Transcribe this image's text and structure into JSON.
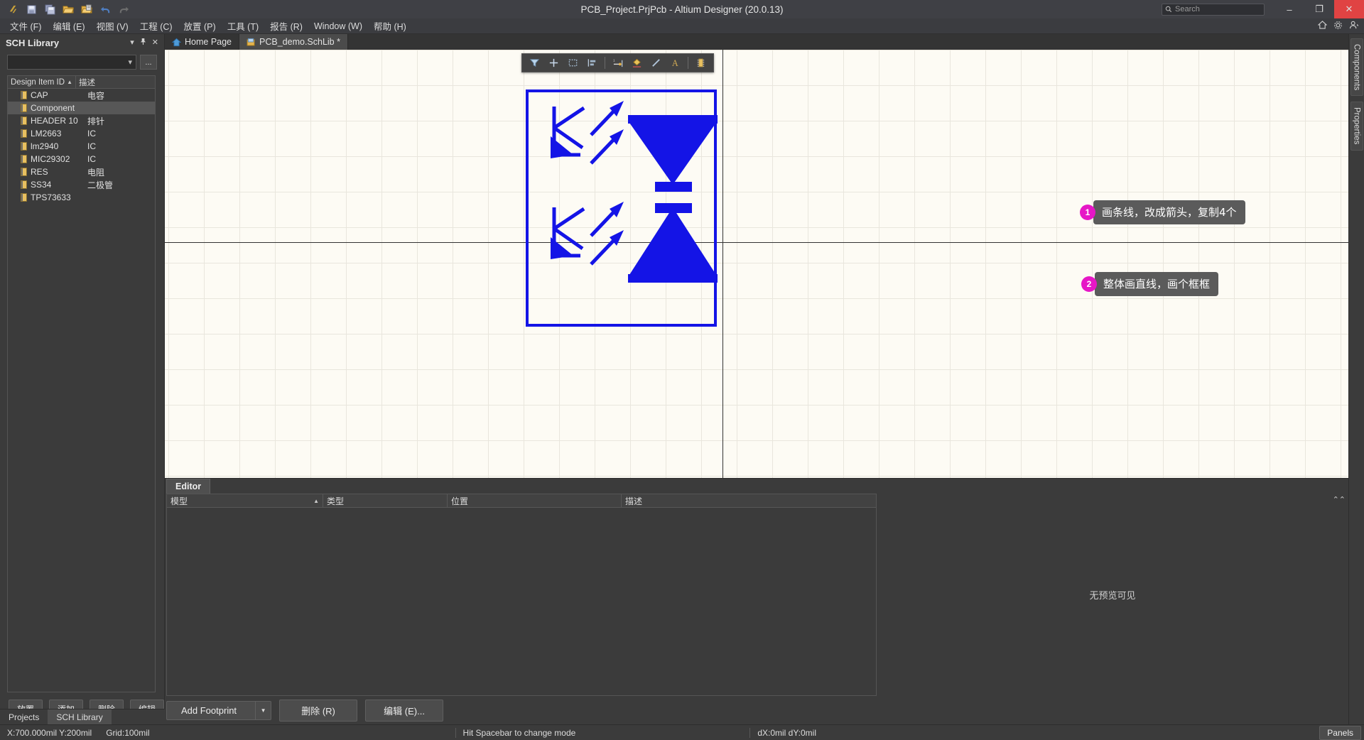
{
  "titlebar": {
    "title": "PCB_Project.PrjPcb - Altium Designer (20.0.13)",
    "quick_icons": [
      "altium-logo-icon",
      "save-icon",
      "save-all-icon",
      "open-icon",
      "open-project-icon",
      "undo-icon",
      "redo-icon"
    ],
    "search_placeholder": "Search",
    "minimize": "–",
    "maximize": "❐",
    "close": "✕"
  },
  "menubar": {
    "items": [
      {
        "label": "文件 (F)"
      },
      {
        "label": "编辑 (E)"
      },
      {
        "label": "视图 (V)"
      },
      {
        "label": "工程 (C)"
      },
      {
        "label": "放置 (P)"
      },
      {
        "label": "工具 (T)"
      },
      {
        "label": "报告 (R)"
      },
      {
        "label": "Window (W)"
      },
      {
        "label": "帮助 (H)"
      }
    ],
    "right_icons": [
      "home-icon",
      "gear-icon",
      "user-icon"
    ]
  },
  "sidebar": {
    "title": "SCH Library",
    "header_icons": [
      "chevron-down-icon",
      "pin-icon",
      "close-icon"
    ],
    "filter_value": "",
    "browse_button": "...",
    "columns": [
      "Design Item ID",
      "描述"
    ],
    "sort_column": "Design Item ID",
    "items": [
      {
        "id": "CAP",
        "desc": "电容",
        "selected": false
      },
      {
        "id": "Component",
        "desc": "",
        "selected": true
      },
      {
        "id": "HEADER 10",
        "desc": "排针",
        "selected": false
      },
      {
        "id": "LM2663",
        "desc": "IC",
        "selected": false
      },
      {
        "id": "lm2940",
        "desc": "IC",
        "selected": false
      },
      {
        "id": "MIC29302",
        "desc": "IC",
        "selected": false
      },
      {
        "id": "RES",
        "desc": "电阻",
        "selected": false
      },
      {
        "id": "SS34",
        "desc": "二极管",
        "selected": false
      },
      {
        "id": "TPS73633",
        "desc": "",
        "selected": false
      }
    ],
    "buttons": [
      "放置",
      "添加",
      "删除",
      "编辑"
    ],
    "bottom_tabs": [
      {
        "label": "Projects",
        "active": false
      },
      {
        "label": "SCH Library",
        "active": true
      }
    ]
  },
  "document_tabs": [
    {
      "label": "Home Page",
      "icon": "home-icon",
      "active": false,
      "modified": false
    },
    {
      "label": "PCB_demo.SchLib *",
      "icon": "schlib-icon",
      "active": true,
      "modified": true
    }
  ],
  "canvas": {
    "floating_toolbar": [
      {
        "icon": "filter-icon"
      },
      {
        "icon": "crosshair-icon"
      },
      {
        "icon": "selection-rect-icon"
      },
      {
        "icon": "align-icon"
      },
      {
        "sep": true
      },
      {
        "icon": "place-pin-icon"
      },
      {
        "icon": "place-polygon-icon"
      },
      {
        "icon": "place-line-icon"
      },
      {
        "icon": "place-text-icon"
      },
      {
        "sep2": true
      },
      {
        "icon": "place-component-icon"
      }
    ],
    "symbol_color": "#1414e6",
    "accent_color": "#e617c6",
    "callouts": [
      {
        "num": "1",
        "text": "画条线，改成箭头，复制4个"
      },
      {
        "num": "2",
        "text": "整体画直线，画个框框"
      }
    ]
  },
  "editor_panel": {
    "tab": "Editor",
    "columns": [
      "模型",
      "类型",
      "位置",
      "描述"
    ],
    "rows": [],
    "preview_text": "无预览可见",
    "collapse_icon": "collapse-icon",
    "buttons": {
      "add_footprint": "Add Footprint",
      "add_footprint_arrow": "▼",
      "delete": "删除 (R)",
      "edit": "编辑 (E)..."
    }
  },
  "right_dock": {
    "tabs": [
      "Components",
      "Properties"
    ]
  },
  "statusbar": {
    "coords": "X:700.000mil Y:200mil",
    "grid": "Grid:100mil",
    "hint": "Hit Spacebar to change mode",
    "delta": "dX:0mil dY:0mil",
    "panels_button": "Panels"
  }
}
